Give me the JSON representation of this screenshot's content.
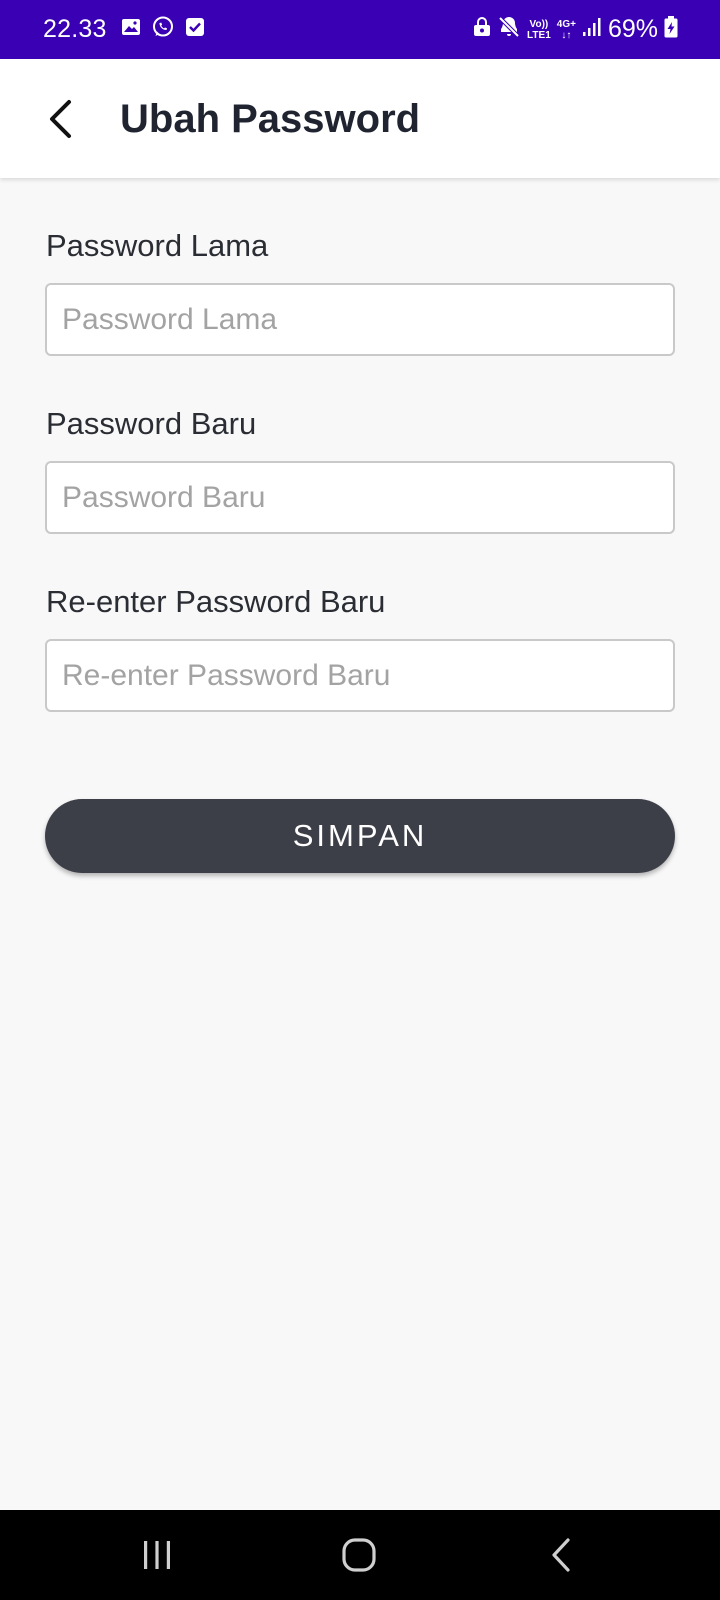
{
  "status_bar": {
    "time": "22.33",
    "battery_percent": "69%",
    "volte_top": "Vo))",
    "volte_bottom": "LTE1",
    "network_type": "4G+",
    "network_arrows": "↓↑",
    "left_icons": [
      "gallery-icon",
      "whatsapp-icon",
      "checkbox-icon"
    ],
    "right_icons": [
      "secure-folder-icon",
      "mute-icon",
      "volte-icon",
      "network-4g-icon",
      "signal-icon",
      "battery-charging-icon"
    ],
    "background_color": "#3a00b4"
  },
  "app_bar": {
    "title": "Ubah Password",
    "back_icon": "back-arrow-icon"
  },
  "form": {
    "old_password": {
      "label": "Password Lama",
      "placeholder": "Password Lama",
      "value": ""
    },
    "new_password": {
      "label": "Password Baru",
      "placeholder": "Password Baru",
      "value": ""
    },
    "confirm_password": {
      "label": "Re-enter Password Baru",
      "placeholder": "Re-enter Password Baru",
      "value": ""
    },
    "save_label": "SIMPAN",
    "save_color": "#3c3f48"
  },
  "nav_bar": {
    "icons": [
      "recent-apps-icon",
      "home-icon",
      "back-icon"
    ]
  }
}
